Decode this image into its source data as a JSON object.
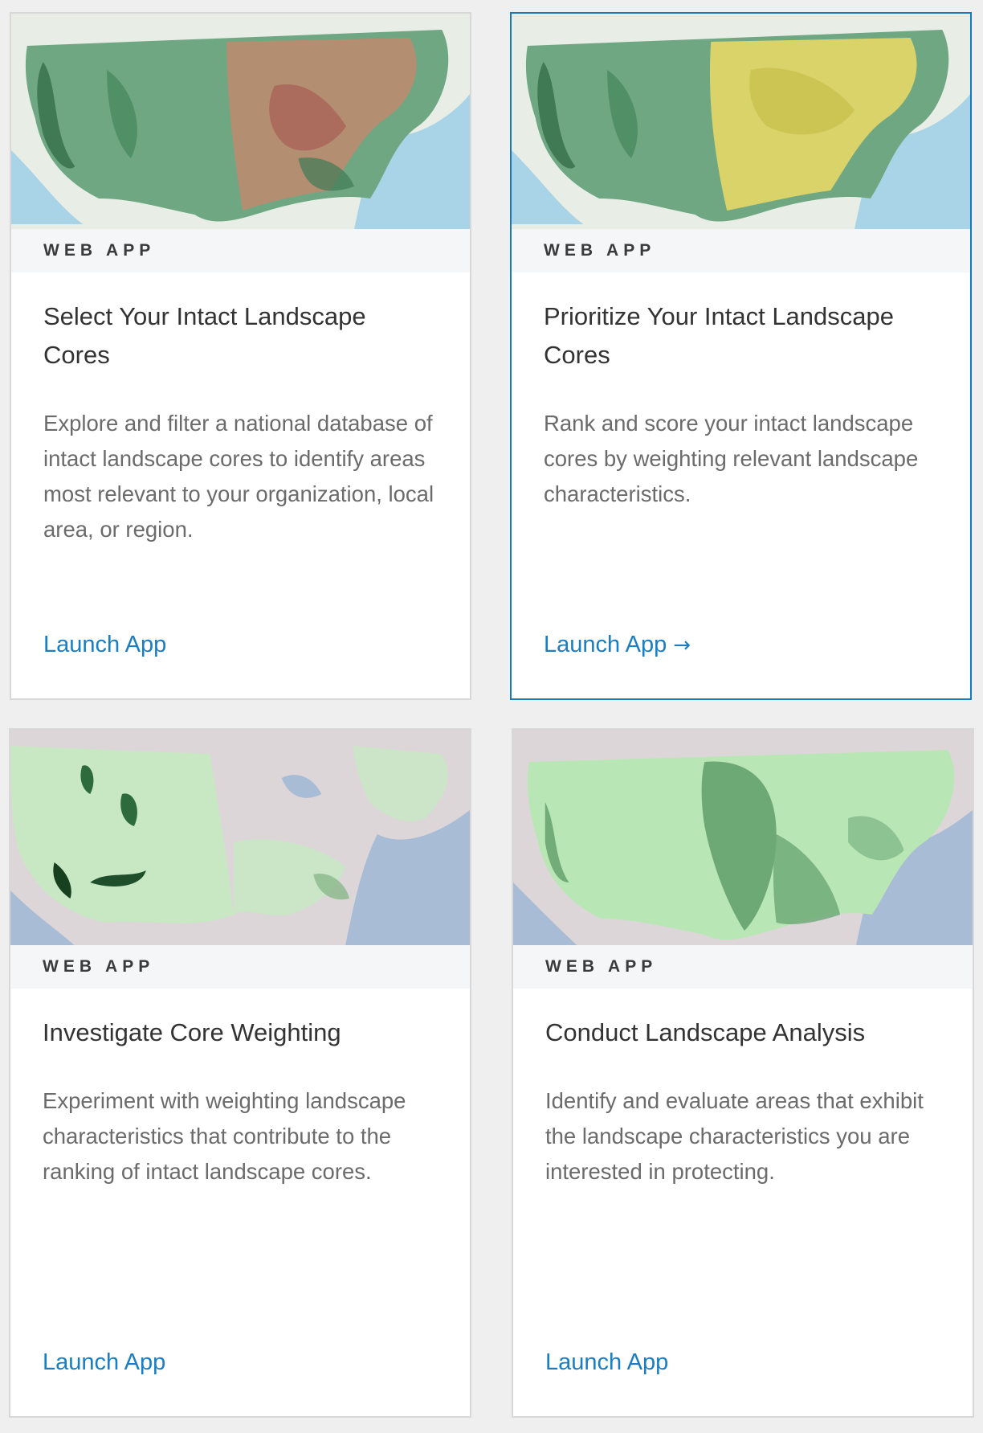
{
  "cards": [
    {
      "kind": "WEB APP",
      "title": "Select Your Intact Landscape Cores",
      "description": "Explore and filter a national database of intact landscape cores to identify areas most relevant to your organization, local area, or region.",
      "link_label": "Launch App",
      "link_icon": "",
      "map_style": "green-red-ramp"
    },
    {
      "kind": "WEB APP",
      "title": "Prioritize Your Intact Landscape Cores",
      "description": "Rank and score your intact landscape cores by weighting relevant landscape characteristics.",
      "link_label": "Launch App",
      "link_icon": "→",
      "map_style": "green-yellow-ramp"
    },
    {
      "kind": "WEB APP",
      "title": "Investigate Core Weighting",
      "description": "Experiment with weighting landscape characteristics that contribute to the ranking of intact landscape cores.",
      "link_label": "Launch App",
      "link_icon": "",
      "map_style": "light-green-sparse"
    },
    {
      "kind": "WEB APP",
      "title": "Conduct Landscape Analysis",
      "description": "Identify and evaluate areas that exhibit the landscape characteristics you are interested in protecting.",
      "link_label": "Launch App",
      "link_icon": "",
      "map_style": "green-dense"
    }
  ],
  "colors": {
    "link": "#1b7ec2",
    "active_border": "#1a7ab8",
    "card_border": "#d8d8d8",
    "background": "#efefef"
  }
}
